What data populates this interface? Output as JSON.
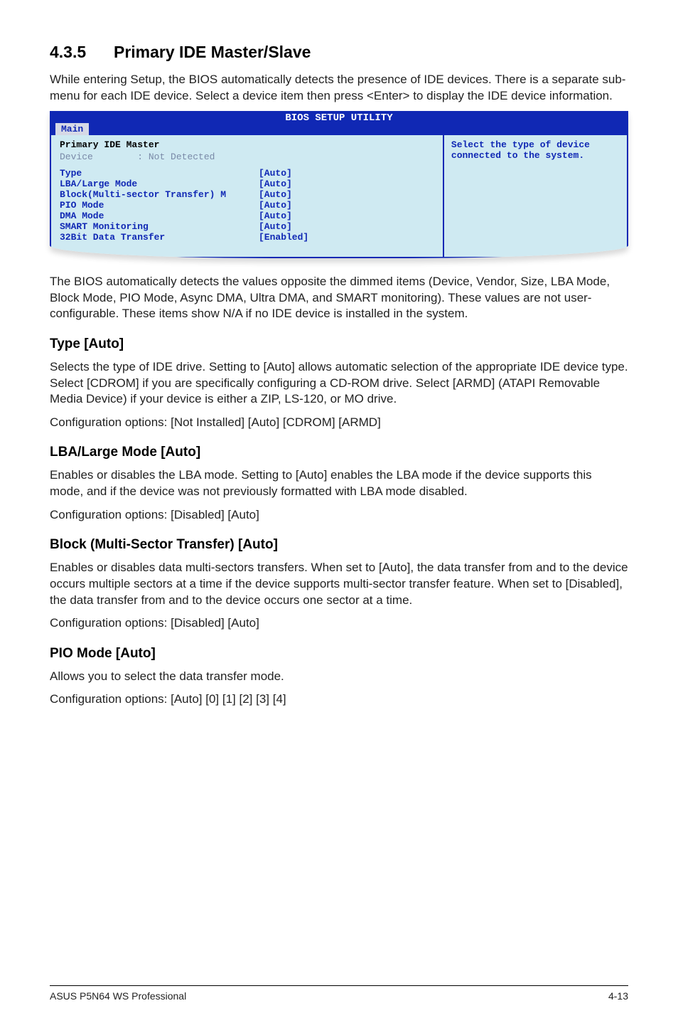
{
  "section": {
    "number": "4.3.5",
    "title": "Primary IDE Master/Slave",
    "intro": "While entering Setup, the BIOS automatically detects the presence of IDE devices. There is a separate sub-menu for each IDE device. Select a device item then press <Enter> to display the IDE device information."
  },
  "bios": {
    "utility_title": "BIOS SETUP UTILITY",
    "tab": "Main",
    "panel_title": "Primary IDE Master",
    "device_label": "Device",
    "device_value": ": Not Detected",
    "help": "Select the type of device connected to the system.",
    "rows": [
      {
        "key": "Type",
        "val": "[Auto]"
      },
      {
        "key": "LBA/Large Mode",
        "val": "[Auto]"
      },
      {
        "key": "Block(Multi-sector Transfer) M",
        "val": "[Auto]"
      },
      {
        "key": "PIO Mode",
        "val": "[Auto]"
      },
      {
        "key": "DMA Mode",
        "val": "[Auto]"
      },
      {
        "key": "SMART Monitoring",
        "val": "[Auto]"
      },
      {
        "key": "32Bit Data Transfer",
        "val": "[Enabled]"
      }
    ]
  },
  "after_bios": "The BIOS automatically detects the values opposite the dimmed items (Device, Vendor, Size, LBA Mode, Block Mode, PIO Mode, Async DMA, Ultra DMA, and SMART monitoring). These values are not user-configurable. These items show N/A if no IDE device is installed in the system.",
  "type": {
    "heading": "Type [Auto]",
    "p1": "Selects the type of IDE drive. Setting to [Auto] allows automatic selection of the appropriate IDE device type. Select [CDROM] if you are specifically configuring a CD-ROM drive. Select [ARMD] (ATAPI Removable Media Device) if your device is either a ZIP, LS-120, or MO drive.",
    "p2": "Configuration options: [Not Installed] [Auto] [CDROM] [ARMD]"
  },
  "lba": {
    "heading": "LBA/Large Mode [Auto]",
    "p1": "Enables or disables the LBA mode. Setting to [Auto] enables the LBA mode if the device supports this mode, and if the device was not previously formatted with LBA mode disabled.",
    "p2": "Configuration options: [Disabled] [Auto]"
  },
  "block": {
    "heading": "Block (Multi-Sector Transfer) [Auto]",
    "p1": "Enables or disables data multi-sectors transfers. When set to [Auto], the data transfer from and to the device occurs multiple sectors at a time if the device supports multi-sector transfer feature. When set to [Disabled], the data transfer from and to the device occurs one sector at a time.",
    "p2": "Configuration options: [Disabled] [Auto]"
  },
  "pio": {
    "heading": "PIO Mode [Auto]",
    "p1": "Allows you to select the data transfer mode.",
    "p2": "Configuration options: [Auto] [0] [1] [2] [3] [4]"
  },
  "footer": {
    "left": "ASUS P5N64 WS Professional",
    "right": "4-13"
  }
}
